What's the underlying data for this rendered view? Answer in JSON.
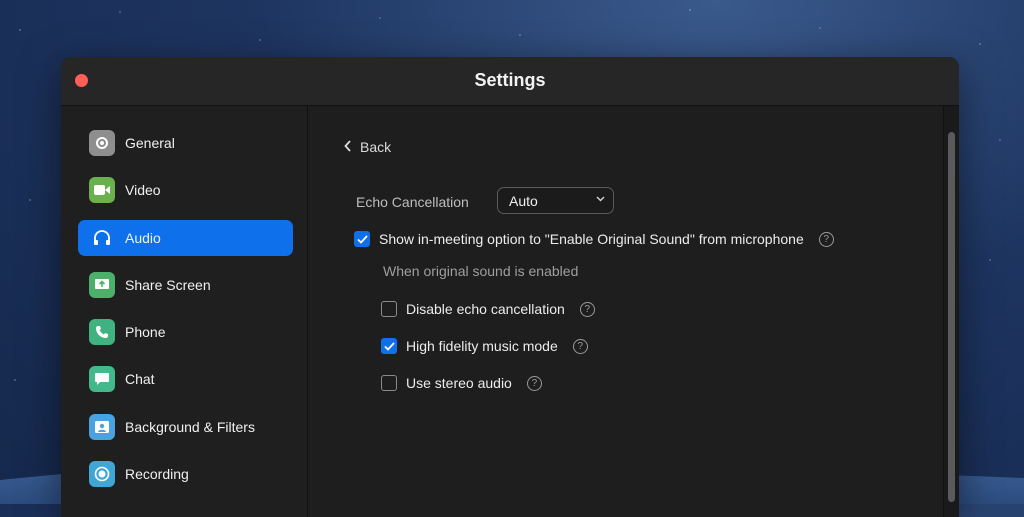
{
  "window": {
    "title": "Settings"
  },
  "sidebar": {
    "items": [
      {
        "label": "General",
        "icon": "gear-icon",
        "color": "#9b9b9b"
      },
      {
        "label": "Video",
        "icon": "video-camera-icon",
        "color": "#6ab04c"
      },
      {
        "label": "Audio",
        "icon": "headphones-icon",
        "color": "#0e71eb",
        "active": true
      },
      {
        "label": "Share Screen",
        "icon": "share-screen-icon",
        "color": "#4caf6a"
      },
      {
        "label": "Phone",
        "icon": "phone-icon",
        "color": "#3fb27f"
      },
      {
        "label": "Chat",
        "icon": "chat-icon",
        "color": "#43b88a"
      },
      {
        "label": "Background & Filters",
        "icon": "background-icon",
        "color": "#4aa3df"
      },
      {
        "label": "Recording",
        "icon": "record-icon",
        "color": "#3fa7d6"
      }
    ]
  },
  "content": {
    "back_label": "Back",
    "echo_label": "Echo Cancellation",
    "echo_value": "Auto",
    "original_sound_option": {
      "label": "Show in-meeting option to \"Enable Original Sound\" from microphone",
      "checked": true
    },
    "sub_heading": "When original sound is enabled",
    "options": [
      {
        "label": "Disable echo cancellation",
        "checked": false
      },
      {
        "label": "High fidelity music mode",
        "checked": true
      },
      {
        "label": "Use stereo audio",
        "checked": false
      }
    ],
    "help_glyph": "?"
  }
}
